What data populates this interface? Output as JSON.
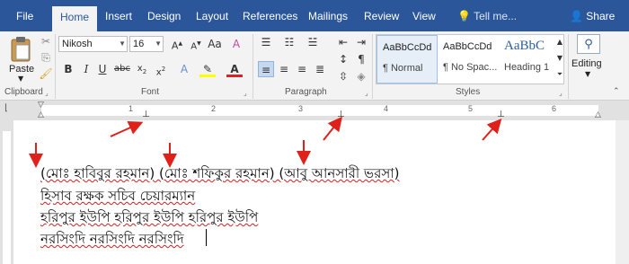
{
  "tabs": [
    {
      "label": "File"
    },
    {
      "label": "Home"
    },
    {
      "label": "Insert"
    },
    {
      "label": "Design"
    },
    {
      "label": "Layout"
    },
    {
      "label": "References"
    },
    {
      "label": "Mailings"
    },
    {
      "label": "Review"
    },
    {
      "label": "View"
    }
  ],
  "active_tab": "Home",
  "tell_me": "Tell me...",
  "share_label": "Share",
  "clipboard": {
    "paste_label": "Paste",
    "group_label": "Clipboard"
  },
  "font": {
    "family": "Nikosh",
    "size": "16",
    "group_label": "Font"
  },
  "paragraph": {
    "group_label": "Paragraph"
  },
  "styles": {
    "group_label": "Styles",
    "items": [
      {
        "sample": "AaBbCcDd",
        "name": "¶ Normal"
      },
      {
        "sample": "AaBbCcDd",
        "name": "¶ No Spac..."
      },
      {
        "sample": "AaBbC",
        "name": "Heading 1"
      }
    ]
  },
  "editing": {
    "label": "Editing"
  },
  "ruler": {
    "numbers": [
      "1",
      "2",
      "3",
      "4",
      "5",
      "6"
    ]
  },
  "document": {
    "lines": [
      "(মোঃ হাবিবুর রহমান) (মোঃ শফিকুর রহমান) (আবু আনসারী ভরসা)",
      "হিসাব রক্ষক সচিব চেয়ারম্যান",
      "হরিপুর ইউপি হরিপুর ইউপি হরিপুর ইউপি",
      "নরসিংদি নরসিংদি নরসিংদি"
    ]
  },
  "colors": {
    "accent": "#2b579a",
    "annotation_arrow": "#e0201a",
    "spell_underline": "#d02020"
  }
}
